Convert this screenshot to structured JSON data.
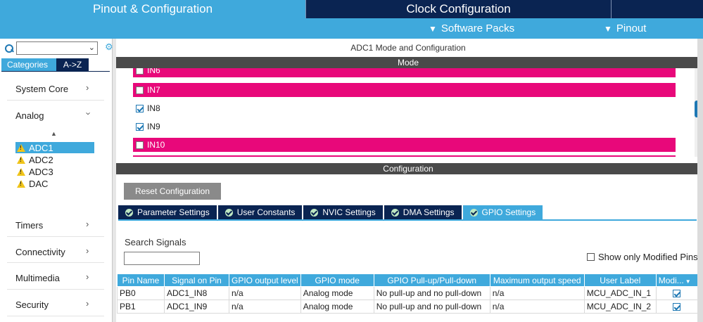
{
  "top_tabs": [
    "Pinout & Configuration",
    "Clock Configuration"
  ],
  "sub_menu": [
    {
      "label": "Software Packs",
      "icon": "chevron-down-icon"
    },
    {
      "label": "Pinout",
      "icon": "chevron-down-icon"
    }
  ],
  "sidebar": {
    "search": {
      "value": ""
    },
    "tabs": [
      "Categories",
      "A->Z"
    ],
    "categories": [
      "System Core",
      "Analog",
      "Timers",
      "Connectivity",
      "Multimedia",
      "Security"
    ],
    "analog_items": [
      "ADC1",
      "ADC2",
      "ADC3",
      "DAC"
    ],
    "selected": "ADC1"
  },
  "main": {
    "title": "ADC1 Mode and Configuration",
    "mode_header": "Mode",
    "mode_rows": [
      {
        "label": "IN6",
        "checked": false,
        "highlight": true
      },
      {
        "label": "IN7",
        "checked": false,
        "highlight": true
      },
      {
        "label": "IN8",
        "checked": true,
        "highlight": false
      },
      {
        "label": "IN9",
        "checked": true,
        "highlight": false
      },
      {
        "label": "IN10",
        "checked": false,
        "highlight": true
      }
    ],
    "config_header": "Configuration",
    "reset_label": "Reset Configuration",
    "config_tabs": [
      "Parameter Settings",
      "User Constants",
      "NVIC Settings",
      "DMA Settings",
      "GPIO Settings"
    ],
    "active_tab": "GPIO Settings",
    "search_label": "Search Signals",
    "search_value": "",
    "modified_label": "Show only Modified Pins"
  },
  "table": {
    "columns": [
      "Pin Name",
      "Signal on Pin",
      "GPIO output level",
      "GPIO mode",
      "GPIO Pull-up/Pull-down",
      "Maximum output speed",
      "User Label",
      "Modi..."
    ],
    "rows": [
      [
        "PB0",
        "ADC1_IN8",
        "n/a",
        "Analog mode",
        "No pull-up and no pull-down",
        "n/a",
        "MCU_ADC_IN_1"
      ],
      [
        "PB1",
        "ADC1_IN9",
        "n/a",
        "Analog mode",
        "No pull-up and no pull-down",
        "n/a",
        "MCU_ADC_IN_2"
      ]
    ]
  },
  "colors": {
    "accent": "#3fa9dc",
    "dark": "#0a2452",
    "highlight": "#e8087a"
  }
}
